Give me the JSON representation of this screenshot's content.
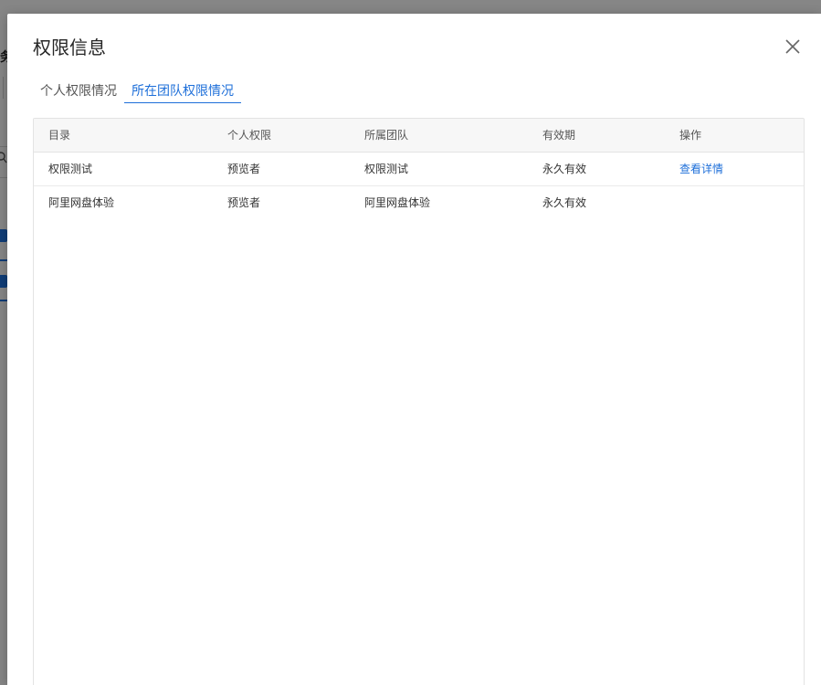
{
  "background": {
    "fragment_text": "务"
  },
  "dialog": {
    "title": "权限信息",
    "tabs": [
      {
        "label": "个人权限情况",
        "active": false
      },
      {
        "label": "所在团队权限情况",
        "active": true
      }
    ],
    "table": {
      "columns": [
        "目录",
        "个人权限",
        "所属团队",
        "有效期",
        "操作"
      ],
      "rows": [
        {
          "directory": "权限测试",
          "permission": "预览者",
          "team": "权限测试",
          "validity": "永久有效",
          "action": "查看详情"
        },
        {
          "directory": "阿里网盘体验",
          "permission": "预览者",
          "team": "阿里网盘体验",
          "validity": "永久有效",
          "action": ""
        }
      ]
    }
  },
  "colors": {
    "accent": "#1e6fd9",
    "overlay": "rgba(0,0,0,0.45)"
  },
  "icons": {
    "close": "close-icon",
    "search": "search-icon",
    "checkbox": "checkbox-checked-icon"
  }
}
